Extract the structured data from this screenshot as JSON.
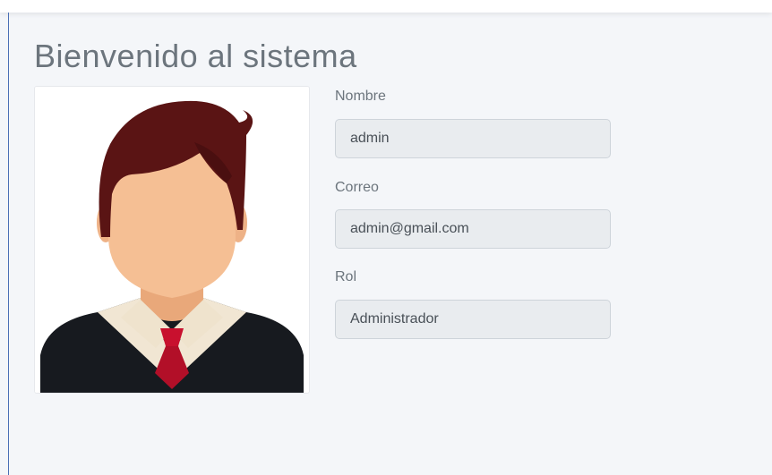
{
  "page": {
    "title": "Bienvenido al sistema"
  },
  "profile": {
    "avatar_icon": "user-avatar-icon",
    "name_label": "Nombre",
    "name_value": "admin",
    "email_label": "Correo",
    "email_value": "admin@gmail.com",
    "role_label": "Rol",
    "role_value": "Administrador"
  },
  "colors": {
    "background": "#f4f6f9",
    "input_bg": "#e9ecef",
    "text_muted": "#6c757d",
    "hair": "#5a1414",
    "skin": "#f5bf94",
    "suit": "#1a1a1a",
    "tie": "#c8102e"
  }
}
